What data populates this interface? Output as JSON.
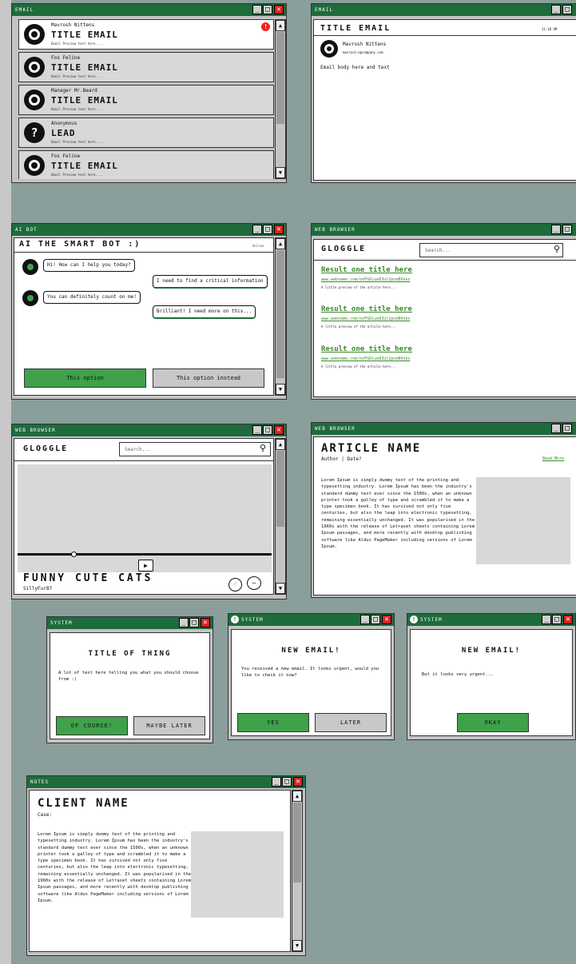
{
  "email_list_window": {
    "title": "EMAIL",
    "emails": [
      {
        "sender": "Mavrosh Nittens",
        "subject": "TITLE EMAIL",
        "preview": "Email Preview text here...."
      },
      {
        "sender": "Fos Feline",
        "subject": "TITLE EMAIL",
        "preview": "Email Preview text here...."
      },
      {
        "sender": "Manager Mr.Beard",
        "subject": "TITLE EMAIL",
        "preview": "Email Preview text here...."
      },
      {
        "sender": "Anonymous",
        "subject": "LEAD",
        "preview": "Email Preview text here...."
      },
      {
        "sender": "Fos Feline",
        "subject": "TITLE EMAIL",
        "preview": "Email Preview text here...."
      }
    ]
  },
  "email_view_window": {
    "title": "EMAIL",
    "subject": "TITLE EMAIL",
    "time": "11:10 AM",
    "sender": "Mavrosh Nittens",
    "sender_email": "mavrosh.n@company.com",
    "body": "Email body here and text"
  },
  "bot_window": {
    "title": "AI BOT",
    "header": "AI THE SMART BOT :)",
    "status": "Online",
    "messages": [
      "Hi! How can I help you today?",
      "I need to find a critical information",
      "You can definitely count on me!",
      "Brilliant! I need more on this..."
    ],
    "option1": "This option",
    "option2": "This option instead"
  },
  "search_window": {
    "title": "WEB BROWSER",
    "logo": "GLOGGLE",
    "search_placeholder": "Search...",
    "results": [
      {
        "title": "Result one title here",
        "url": "www.webname.com/onFGDiue83ul2pcmBVnks",
        "desc": "A little preview of the article here..."
      },
      {
        "title": "Result one title here",
        "url": "www.webname.com/onFGDiue83ul2pcmBVnks",
        "desc": "A little preview of the article here..."
      },
      {
        "title": "Result one title here",
        "url": "www.webname.com/onFGDiue83ul2pcmBVnks",
        "desc": "A little preview of the article here..."
      }
    ]
  },
  "video_window": {
    "title": "WEB BROWSER",
    "logo": "GLOGGLE",
    "search_placeholder": "Search...",
    "video_title": "FUNNY CUTE CATS",
    "uploader": "SillyFur87"
  },
  "article_window": {
    "title": "WEB BROWSER",
    "heading": "ARTICLE NAME",
    "byline": "Author | Date?",
    "read_more": "Read More",
    "body": "Lorem Ipsum is simply dummy text of the printing and typesetting industry. Lorem Ipsum has been the industry's standard dummy text ever since the 1500s, when an unknown printer took a galley of type and scrambled it to make a type specimen book. It has survived not only five centuries, but also the leap into electronic typesetting, remaining essentially unchanged. It was popularised in the 1960s with the release of Letraset sheets containing Lorem Ipsum passages, and more recently with desktop publishing software like Aldus PageMaker including versions of Lorem Ipsum."
  },
  "system1": {
    "title": "SYSTEM",
    "heading": "TITLE OF THING",
    "text": "A lot of text here telling you what you should choose from :)",
    "ok": "OF COURSE!",
    "later": "MAYBE LATER"
  },
  "system2": {
    "title": "SYSTEM",
    "heading": "NEW EMAIL!",
    "text": "You received a new email. It looks urgent, would you like to check it now?",
    "yes": "YES",
    "later": "LATER"
  },
  "system3": {
    "title": "SYSTEM",
    "heading": "NEW EMAIL!",
    "text": "But it looks very urgent...",
    "okay": "OKAY"
  },
  "notes_window": {
    "title": "NOTES",
    "heading": "CLIENT NAME",
    "case": "Case:",
    "body": "Lorem Ipsum is simply dummy text of the printing and typesetting industry. Lorem Ipsum has been the industry's standard dummy text ever since the 1500s, when an unknown printer took a galley of type and scrambled it to make a type specimen book. It has survived not only five centuries, but also the leap into electronic typesetting, remaining essentially unchanged. It was popularised in the 1960s with the release of Letraset sheets containing Lorem Ipsum passages, and more recently with desktop publishing software like Aldus PageMaker including versions of Lorem Ipsum."
  }
}
